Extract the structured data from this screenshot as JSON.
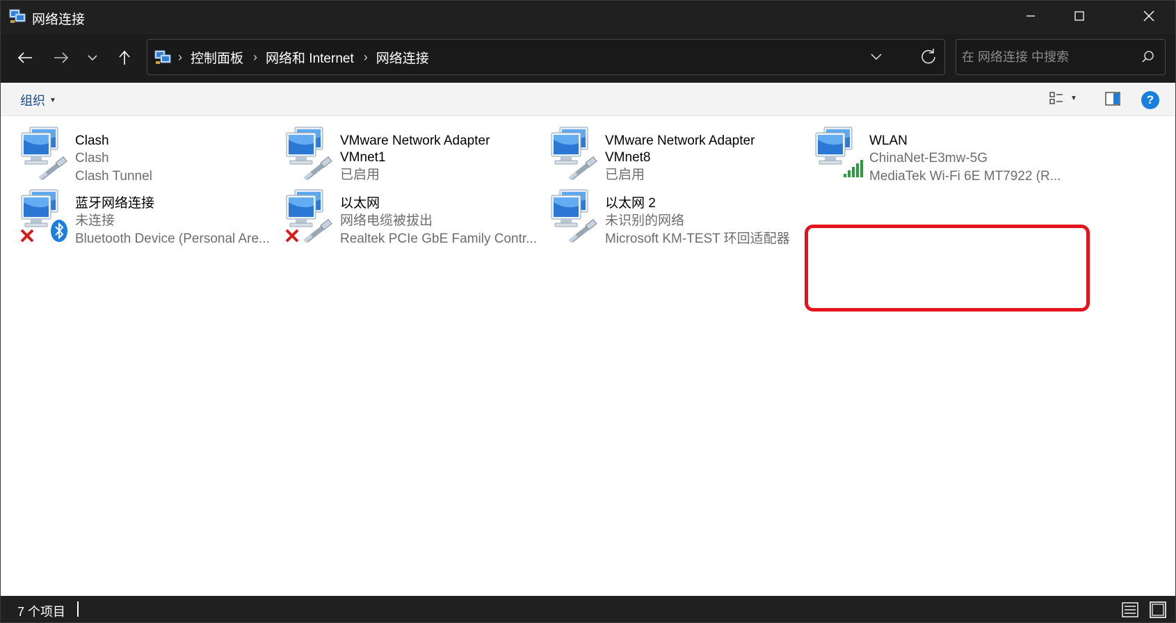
{
  "window": {
    "title": "网络连接",
    "controls": {
      "minimize": "minimize-icon",
      "maximize": "maximize-icon",
      "close": "close-icon"
    }
  },
  "navigation": {
    "back_icon": "arrow-left-icon",
    "forward_icon": "arrow-right-icon",
    "recent_icon": "chevron-down-icon",
    "up_icon": "arrow-up-icon"
  },
  "address": {
    "crumbs": [
      "控制面板",
      "网络和 Internet",
      "网络连接"
    ],
    "separator": "›"
  },
  "search": {
    "placeholder": "在 网络连接 中搜索"
  },
  "toolbar": {
    "organize_label": "组织",
    "help_label": "?"
  },
  "connections": [
    {
      "name": "Clash",
      "line1": "Clash",
      "line2": "Clash Tunnel",
      "status_overlay": "none",
      "badge": "none"
    },
    {
      "name": "VMware Network Adapter VMnet1",
      "line1": "已启用",
      "line2": "",
      "status_overlay": "none",
      "badge": "none"
    },
    {
      "name": "VMware Network Adapter VMnet8",
      "line1": "已启用",
      "line2": "",
      "status_overlay": "none",
      "badge": "none"
    },
    {
      "name": "WLAN",
      "line1": "ChinaNet-E3mw-5G",
      "line2": "MediaTek Wi-Fi 6E MT7922 (R...",
      "status_overlay": "none",
      "badge": "wifi-signal",
      "highlighted": true
    },
    {
      "name": "蓝牙网络连接",
      "line1": "未连接",
      "line2": "Bluetooth Device (Personal Are...",
      "status_overlay": "disconnected",
      "badge": "bluetooth"
    },
    {
      "name": "以太网",
      "line1": "网络电缆被拔出",
      "line2": "Realtek PCIe GbE Family Contr...",
      "status_overlay": "disconnected",
      "badge": "none"
    },
    {
      "name": "以太网 2",
      "line1": "未识别的网络",
      "line2": "Microsoft KM-TEST 环回适配器",
      "status_overlay": "none",
      "badge": "none"
    }
  ],
  "status": {
    "item_count": "7 个项目"
  },
  "colors": {
    "titlebar": "#202020",
    "highlight": "#e3141b",
    "secondary_text": "#6d6d6d",
    "link": "#1a4a8a",
    "help": "#1a7fdc"
  }
}
